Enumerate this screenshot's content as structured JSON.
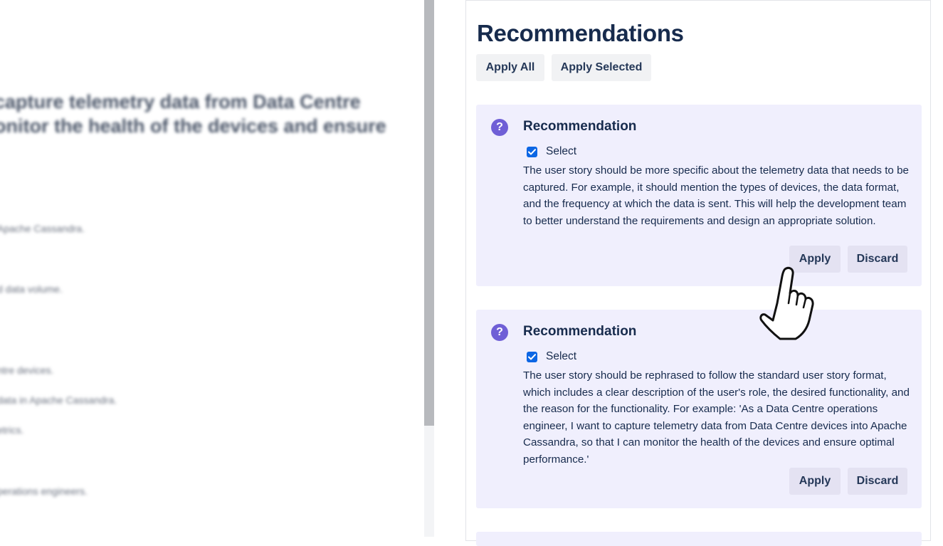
{
  "left_pane": {
    "heading_lines": [
      "capture telemetry data from Data Centre",
      "onitor the health of the devices and ensure"
    ],
    "blurred_lines": [
      "Apache Cassandra.",
      "d data volume.",
      "ntre devices.",
      "data in Apache Cassandra.",
      "etrics.",
      "perations engineers."
    ]
  },
  "recommendations": {
    "title": "Recommendations",
    "apply_all_label": "Apply All",
    "apply_selected_label": "Apply Selected",
    "items": [
      {
        "icon": "question-icon",
        "icon_glyph": "?",
        "title": "Recommendation",
        "select_label": "Select",
        "checked": true,
        "text": "The user story should be more specific about the telemetry data that needs to be captured. For example, it should mention the types of devices, the data format, and the frequency at which the data is sent. This will help the development team to better understand the requirements and design an appropriate solution.",
        "apply_label": "Apply",
        "discard_label": "Discard"
      },
      {
        "icon": "question-icon",
        "icon_glyph": "?",
        "title": "Recommendation",
        "select_label": "Select",
        "checked": true,
        "text": "The user story should be rephrased to follow the standard user story format, which includes a clear description of the user's role, the desired functionality, and the reason for the functionality. For example: 'As a Data Centre operations engineer, I want to capture telemetry data from Data Centre devices into Apache Cassandra, so that I can monitor the health of the devices and ensure optimal performance.'",
        "apply_label": "Apply",
        "discard_label": "Discard"
      }
    ]
  },
  "colors": {
    "card_background": "#f0effd",
    "accent_icon": "#6f5fd6",
    "checkbox": "#0c66e4",
    "text": "#172b4d"
  },
  "cursor": {
    "icon": "hand-pointer-icon"
  }
}
